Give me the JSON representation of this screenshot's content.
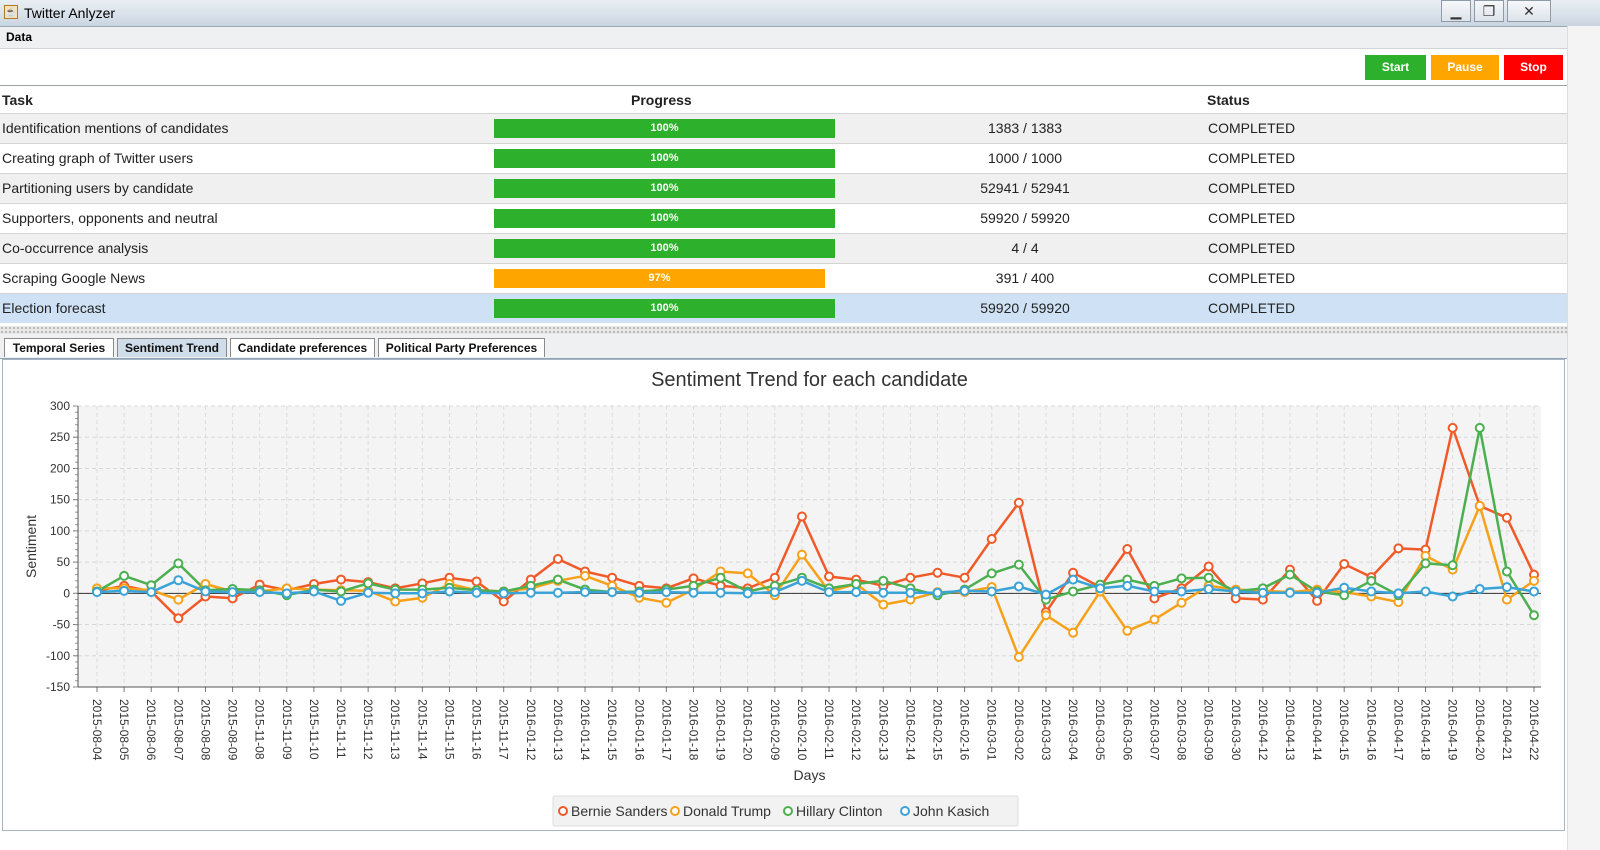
{
  "window": {
    "title": "Twitter Anlyzer",
    "icon": "java-cup-icon"
  },
  "menu": {
    "items": [
      "Data"
    ]
  },
  "toolbar": {
    "start_label": "Start",
    "pause_label": "Pause",
    "stop_label": "Stop",
    "colors": {
      "start": "#2db12d",
      "pause": "#ffa500",
      "stop": "#ff0000"
    }
  },
  "table": {
    "headers": {
      "task": "Task",
      "progress": "Progress",
      "status": "Status"
    },
    "rows": [
      {
        "task": "Identification mentions of candidates",
        "progress": 1.0,
        "progress_label": "100%",
        "count": "1383 / 1383",
        "status": "COMPLETED"
      },
      {
        "task": "Creating graph of Twitter users",
        "progress": 1.0,
        "progress_label": "100%",
        "count": "1000 / 1000",
        "status": "COMPLETED"
      },
      {
        "task": "Partitioning users by candidate",
        "progress": 1.0,
        "progress_label": "100%",
        "count": "52941 / 52941",
        "status": "COMPLETED"
      },
      {
        "task": "Supporters, opponents and neutral",
        "progress": 1.0,
        "progress_label": "100%",
        "count": "59920 / 59920",
        "status": "COMPLETED"
      },
      {
        "task": "Co-occurrence analysis",
        "progress": 1.0,
        "progress_label": "100%",
        "count": "4 / 4",
        "status": "COMPLETED"
      },
      {
        "task": "Scraping Google News",
        "progress": 0.97,
        "progress_label": "97%",
        "count": "391 / 400",
        "status": "COMPLETED"
      },
      {
        "task": "Election forecast",
        "progress": 1.0,
        "progress_label": "100%",
        "count": "59920 / 59920",
        "status": "COMPLETED"
      }
    ],
    "progress_colors": {
      "complete": "#2db12d",
      "partial": "#ffa500"
    },
    "selected_row": 6
  },
  "tabs": [
    {
      "label": "Temporal Series",
      "active": false
    },
    {
      "label": "Sentiment Trend",
      "active": true
    },
    {
      "label": "Candidate preferences",
      "active": false
    },
    {
      "label": "Political Party Preferences",
      "active": false
    }
  ],
  "chart_data": {
    "type": "line",
    "title": "Sentiment Trend for each candidate",
    "xlabel": "Days",
    "ylabel": "Sentiment",
    "ylim": [
      -150,
      300
    ],
    "yticks": [
      -150,
      -100,
      -50,
      0,
      50,
      100,
      150,
      200,
      250,
      300
    ],
    "grid": true,
    "legend_position": "bottom",
    "categories": [
      "2015-08-04",
      "2015-08-05",
      "2015-08-06",
      "2015-08-07",
      "2015-08-08",
      "2015-08-09",
      "2015-11-08",
      "2015-11-09",
      "2015-11-10",
      "2015-11-11",
      "2015-11-12",
      "2015-11-13",
      "2015-11-14",
      "2015-11-15",
      "2015-11-16",
      "2015-11-17",
      "2016-01-12",
      "2016-01-13",
      "2016-01-14",
      "2016-01-15",
      "2016-01-16",
      "2016-01-17",
      "2016-01-18",
      "2016-01-19",
      "2016-01-20",
      "2016-02-09",
      "2016-02-10",
      "2016-02-11",
      "2016-02-12",
      "2016-02-13",
      "2016-02-14",
      "2016-02-15",
      "2016-02-16",
      "2016-03-01",
      "2016-03-02",
      "2016-03-03",
      "2016-03-04",
      "2016-03-05",
      "2016-03-06",
      "2016-03-07",
      "2016-03-08",
      "2016-03-09",
      "2016-03-30",
      "2016-04-12",
      "2016-04-13",
      "2016-04-14",
      "2016-04-15",
      "2016-04-16",
      "2016-04-17",
      "2016-04-18",
      "2016-04-19",
      "2016-04-20",
      "2016-04-21",
      "2016-04-22"
    ],
    "series": [
      {
        "name": "Bernie Sanders",
        "color": "#f05a28",
        "values": [
          4,
          12,
          3,
          -40,
          -5,
          -8,
          14,
          5,
          15,
          22,
          18,
          8,
          16,
          25,
          19,
          -13,
          22,
          55,
          35,
          25,
          12,
          8,
          24,
          12,
          8,
          25,
          123,
          27,
          22,
          12,
          25,
          33,
          25,
          87,
          145,
          -30,
          33,
          10,
          71,
          -8,
          8,
          43,
          -8,
          -10,
          38,
          -12,
          47,
          26,
          72,
          70,
          265,
          140,
          121,
          30
        ]
      },
      {
        "name": "Donald Trump",
        "color": "#f7a11a",
        "values": [
          8,
          8,
          5,
          -10,
          15,
          3,
          3,
          8,
          6,
          5,
          4,
          -13,
          -7,
          15,
          5,
          3,
          8,
          20,
          28,
          12,
          -7,
          -15,
          6,
          35,
          32,
          -3,
          62,
          3,
          15,
          -18,
          -10,
          2,
          2,
          10,
          -102,
          -35,
          -63,
          3,
          -60,
          -42,
          -15,
          12,
          6,
          4,
          2,
          6,
          2,
          -5,
          -14,
          60,
          38,
          140,
          -10,
          20
        ]
      },
      {
        "name": "Hillary Clinton",
        "color": "#4caf50",
        "values": [
          3,
          28,
          13,
          48,
          5,
          7,
          5,
          -3,
          6,
          3,
          16,
          6,
          6,
          9,
          5,
          3,
          12,
          22,
          6,
          2,
          3,
          6,
          12,
          25,
          3,
          12,
          25,
          8,
          15,
          20,
          8,
          -3,
          6,
          32,
          46,
          -10,
          3,
          14,
          22,
          12,
          24,
          25,
          3,
          8,
          30,
          3,
          -3,
          20,
          -3,
          48,
          45,
          265,
          35,
          -35
        ]
      },
      {
        "name": "John Kasich",
        "color": "#3aa3d8",
        "values": [
          2,
          4,
          2,
          21,
          3,
          2,
          2,
          0,
          3,
          -12,
          1,
          0,
          0,
          3,
          1,
          0,
          1,
          1,
          2,
          2,
          1,
          2,
          1,
          1,
          0,
          2,
          20,
          2,
          2,
          1,
          1,
          1,
          4,
          3,
          11,
          -2,
          22,
          8,
          12,
          3,
          3,
          7,
          3,
          1,
          1,
          1,
          9,
          3,
          0,
          3,
          -5,
          7,
          10,
          3
        ]
      }
    ]
  }
}
